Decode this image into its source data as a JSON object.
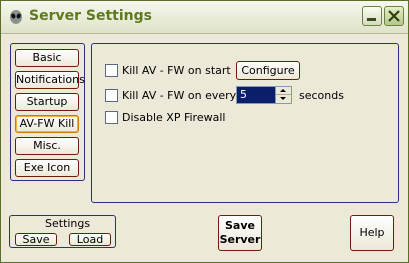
{
  "window": {
    "title": "Server Settings"
  },
  "nav": {
    "items": [
      "Basic",
      "Notifications",
      "Startup",
      "AV-FW Kill",
      "Misc.",
      "Exe Icon"
    ],
    "active": "AV-FW Kill"
  },
  "avfw": {
    "kill_on_start": {
      "label": "Kill AV - FW on start",
      "checked": false
    },
    "configure_label": "Configure",
    "kill_every": {
      "label": "Kill AV - FW on every",
      "checked": false
    },
    "interval_value": "5",
    "interval_unit": "seconds",
    "disable_xp_firewall": {
      "label": "Disable XP Firewall",
      "checked": false
    }
  },
  "settings_group": {
    "title": "Settings",
    "save_label": "Save",
    "load_label": "Load"
  },
  "footer": {
    "save_server_line1": "Save",
    "save_server_line2": "Server",
    "help_label": "Help"
  },
  "colors": {
    "title_text": "#5e7a1e",
    "group_border": "#2a2f8a",
    "button_border": "#6f1c0a",
    "active_tab_border": "#c87d10",
    "spin_bg": "#0a1f6a",
    "window_bg": "#ece9d8"
  },
  "icons": {
    "app": "alien-icon",
    "minimize": "minimize-icon",
    "close": "close-icon",
    "spin_up": "arrow-up-icon",
    "spin_down": "arrow-down-icon"
  }
}
